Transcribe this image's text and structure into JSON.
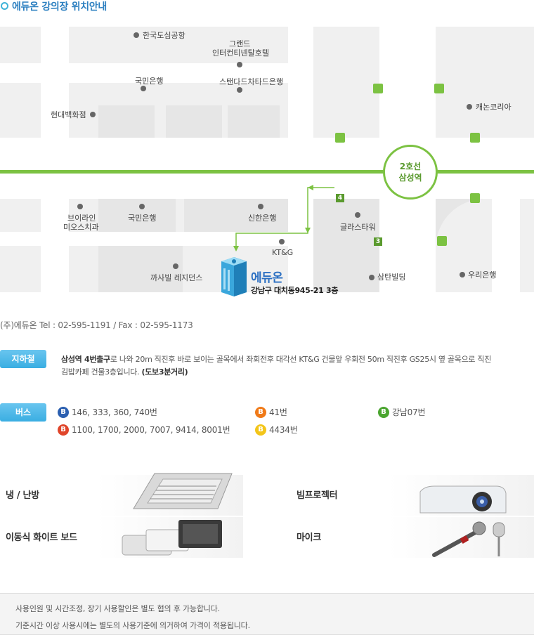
{
  "header": {
    "title": "에듀온 강의장 위치안내"
  },
  "map": {
    "station": {
      "line": "2호선",
      "name": "삼성역"
    },
    "exits": {
      "exit4": "4",
      "exit3": "3"
    },
    "landmarks": {
      "airport": "한국도심공항",
      "grand_line1": "그랜드",
      "grand_line2": "인터컨티넨탈호텔",
      "kookmin_top": "국민은행",
      "standard": "스탠다드차타드은행",
      "hyundai": "현대백화점",
      "canon": "캐논코리아",
      "brilliant_line1": "브이라인",
      "brilliant_line2": "미오스치과",
      "kookmin_bottom": "국민은행",
      "shinhan": "신한은행",
      "glass": "글라스타워",
      "ktg": "KT&G",
      "kasabil": "까사빌 레지던스",
      "samtan": "삼탄빌딩",
      "woori": "우리은행"
    },
    "eduon": {
      "name": "에듀온",
      "address": "강남구 대치동945-21 3층"
    }
  },
  "contact": {
    "line": "(주)에듀온 Tel : 02-595-1191 / Fax : 02-595-1173"
  },
  "subway": {
    "tag": "지하철",
    "bold_part": "삼성역 4번출구",
    "text_part": "로 나와 20m 직진후 바로 보이는 골목에서 좌회전후 대각선 KT&G 건물앞 우회전 50m 직진후 GS25시 옆 골목으로 직진",
    "line2": "김밥카페 건물3층입니다.",
    "walk": "(도보3분거리)"
  },
  "bus": {
    "tag": "버스",
    "routes": [
      {
        "badge": "B",
        "color": "#2b5fb0",
        "text": "146, 333, 360, 740번"
      },
      {
        "badge": "B",
        "color": "#e0452a",
        "text": "1100, 1700, 2000, 7007, 9414, 8001번"
      },
      {
        "badge": "B",
        "color": "#f07a18",
        "text": "41번"
      },
      {
        "badge": "B",
        "color": "#f3c519",
        "text": "4434번"
      },
      {
        "badge": "B",
        "color": "#4aa52f",
        "text": "강남07번"
      }
    ]
  },
  "equipment": {
    "aircon": "냉 / 난방",
    "projector": "빔프로젝터",
    "whiteboard": "이동식 화이트 보드",
    "mic": "마이크"
  },
  "notes": {
    "line1": "사용인원 및 시간조정, 장기 사용할인은 별도 협의 후 가능합니다.",
    "line2": "기준시간 이상 사용시에는 별도의 사용기준에 의거하여 가격이 적용됩니다."
  }
}
